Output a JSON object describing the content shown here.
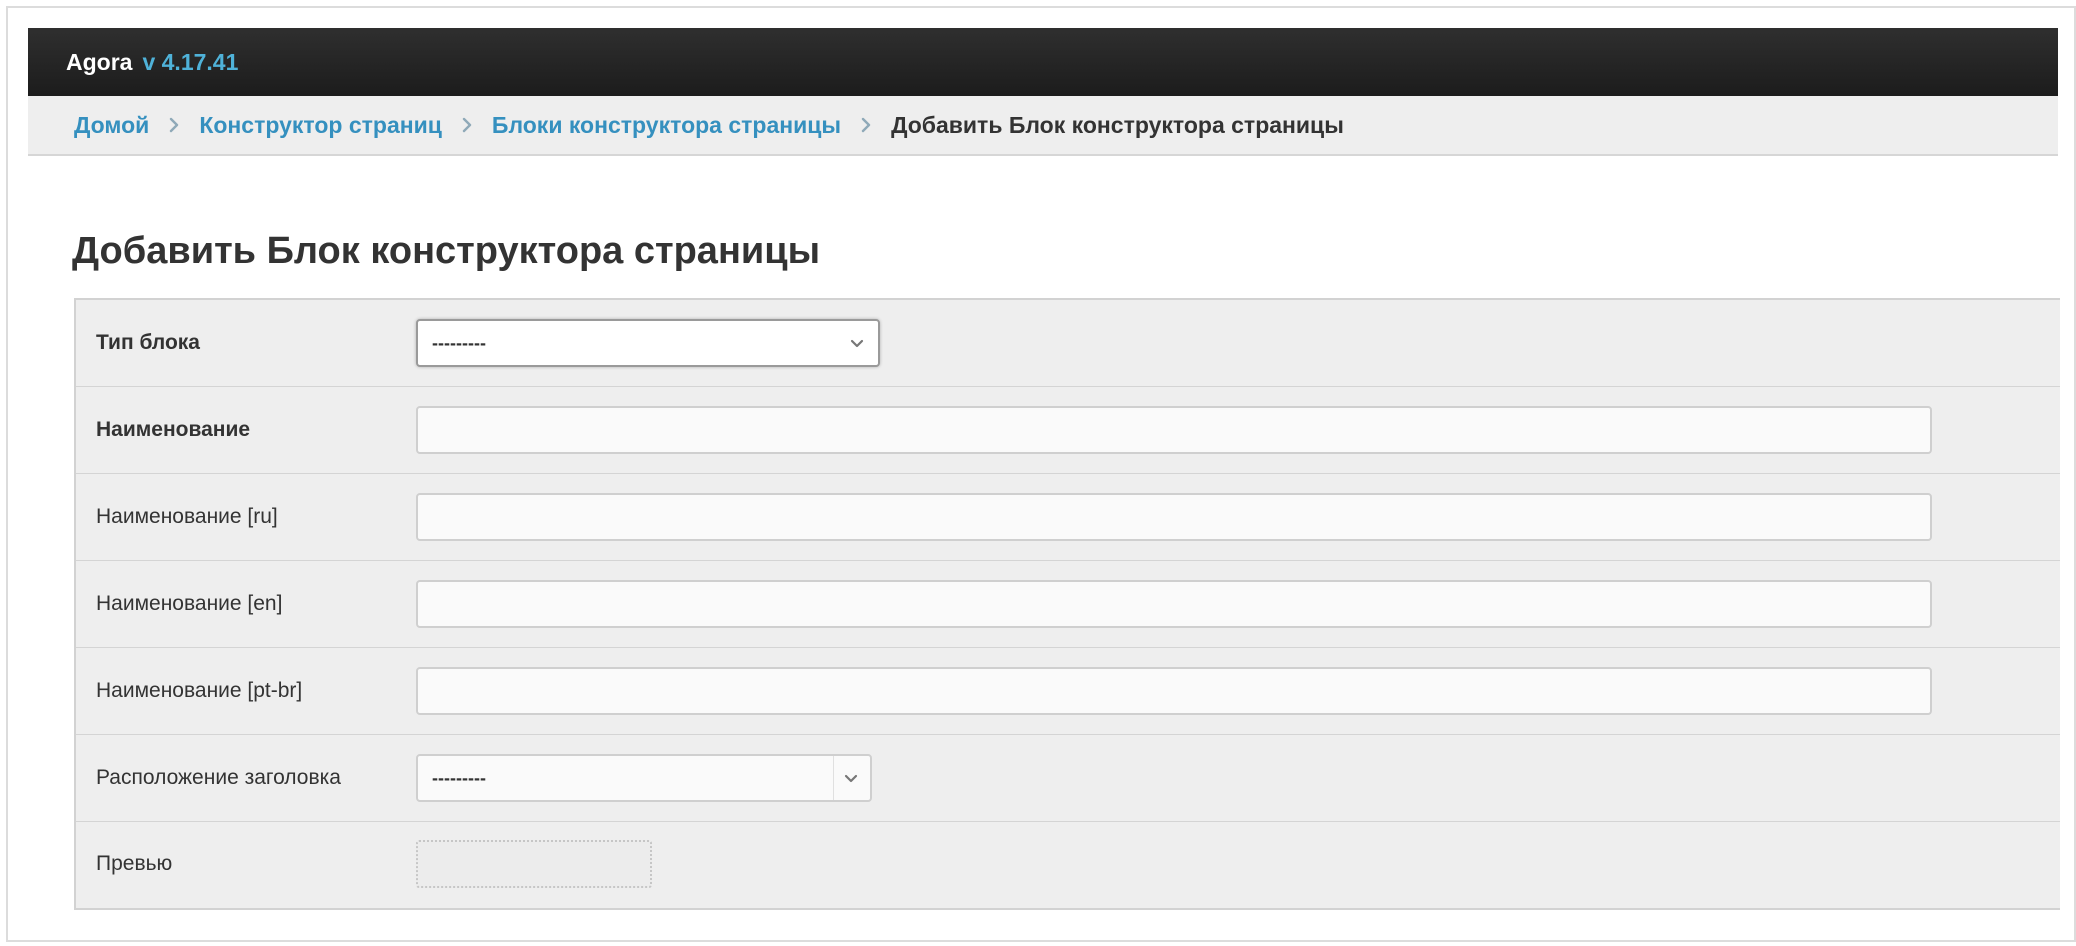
{
  "app": {
    "name": "Agora",
    "version": "v 4.17.41"
  },
  "breadcrumbs": [
    {
      "label": "Домой"
    },
    {
      "label": "Конструктор страниц"
    },
    {
      "label": "Блоки конструктора страницы"
    },
    {
      "label": "Добавить Блок конструктора страницы"
    }
  ],
  "page": {
    "title": "Добавить Блок конструктора страницы"
  },
  "form": {
    "block_type": {
      "label": "Тип блока",
      "value": "---------"
    },
    "name": {
      "label": "Наименование",
      "value": ""
    },
    "name_ru": {
      "label": "Наименование [ru]",
      "value": ""
    },
    "name_en": {
      "label": "Наименование [en]",
      "value": ""
    },
    "name_pt_br": {
      "label": "Наименование [pt-br]",
      "value": ""
    },
    "title_position": {
      "label": "Расположение заголовка",
      "value": "---------"
    },
    "preview": {
      "label": "Превью"
    }
  },
  "colors": {
    "header_bg": "#1c1c1c",
    "version_accent": "#4fb2d9",
    "link": "#3590bf",
    "form_bg": "#eeeeee"
  },
  "icons": {
    "breadcrumb_separator": "chevron-right-icon",
    "select_arrow": "chevron-down-icon"
  }
}
